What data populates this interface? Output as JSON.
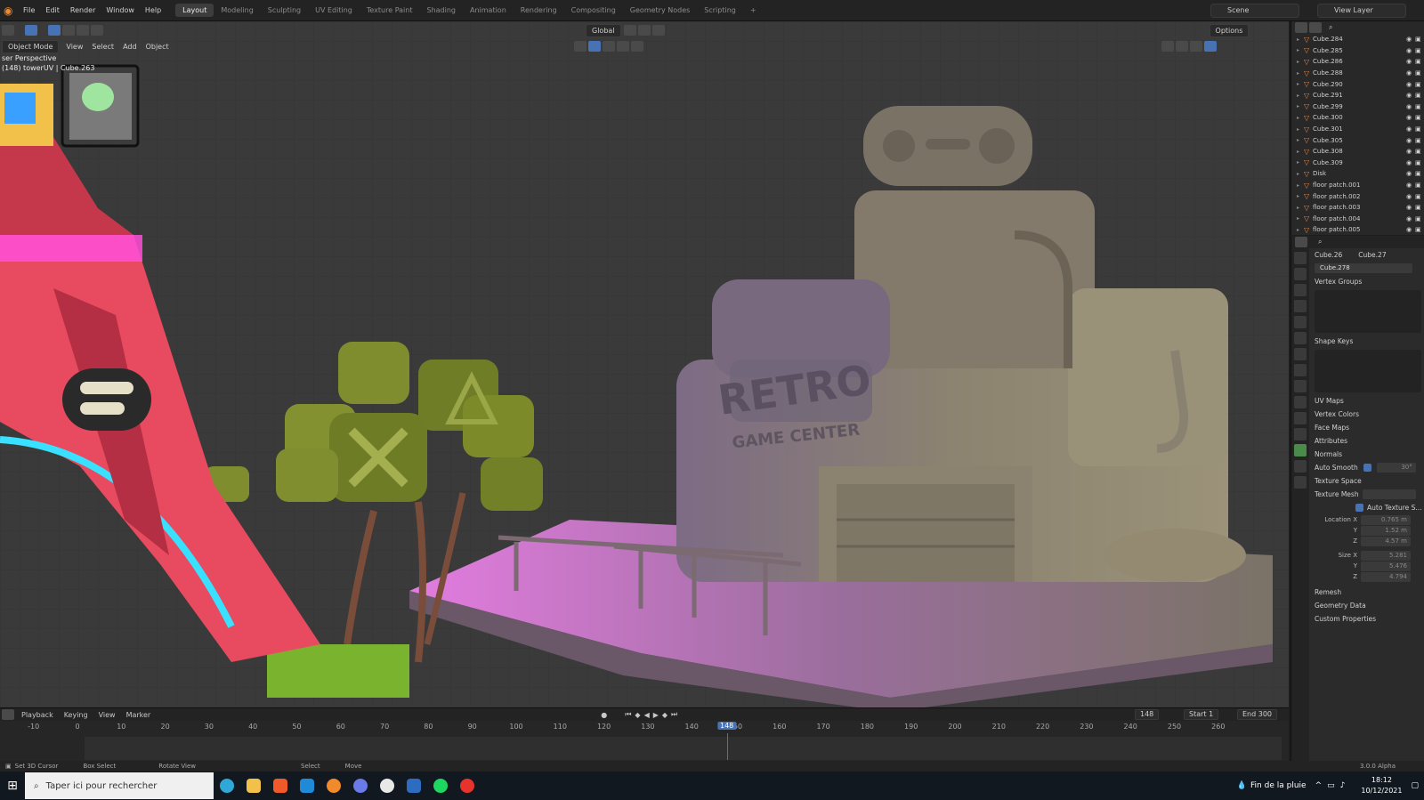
{
  "menu": [
    "File",
    "Edit",
    "Render",
    "Window",
    "Help"
  ],
  "workspaces": [
    "Layout",
    "Modeling",
    "Sculpting",
    "UV Editing",
    "Texture Paint",
    "Shading",
    "Animation",
    "Rendering",
    "Compositing",
    "Geometry Nodes",
    "Scripting"
  ],
  "active_workspace": "Layout",
  "scene": "Scene",
  "view_layer": "View Layer",
  "viewport": {
    "mode": "Object Mode",
    "menus": [
      "View",
      "Select",
      "Add",
      "Object"
    ],
    "orientation": "Global",
    "options": "Options",
    "overlay_line1": "ser Perspective",
    "overlay_line2": "(148) towerUV | Cube.263",
    "sign_retro": "RETRO",
    "sign_sub": "GAME CENTER"
  },
  "timeline": {
    "menus": [
      "Playback",
      "Keying",
      "View",
      "Marker"
    ],
    "ticks": [
      -10,
      0,
      10,
      20,
      30,
      40,
      50,
      60,
      70,
      80,
      90,
      100,
      110,
      120,
      130,
      140,
      150,
      160,
      170,
      180,
      190,
      200,
      210,
      220,
      230,
      240,
      250,
      260
    ],
    "current_frame": "148",
    "current_frame_value": 148,
    "start_label": "Start",
    "start": "1",
    "end_label": "End",
    "end": "300"
  },
  "statusbar": {
    "items": [
      "Set 3D Cursor",
      "Box Select",
      "Rotate View",
      "Select",
      "Move"
    ],
    "version": "3.0.0 Alpha"
  },
  "outliner": {
    "items": [
      "Cube.284",
      "Cube.285",
      "Cube.286",
      "Cube.288",
      "Cube.290",
      "Cube.291",
      "Cube.299",
      "Cube.300",
      "Cube.301",
      "Cube.305",
      "Cube.308",
      "Cube.309",
      "Disk",
      "floor patch.001",
      "floor patch.002",
      "floor patch.003",
      "floor patch.004",
      "floor patch.005"
    ]
  },
  "properties": {
    "object": "Cube.26",
    "mesh_ref": "Cube.27",
    "mesh_name": "Cube.278",
    "vertex_groups": "Vertex Groups",
    "shape_keys": "Shape Keys",
    "sections": [
      "UV Maps",
      "Vertex Colors",
      "Face Maps",
      "Attributes",
      "Normals"
    ],
    "auto_smooth": "Auto Smooth",
    "auto_smooth_angle": "30°",
    "texture_space": "Texture Space",
    "texture_mesh": "Texture Mesh",
    "auto_texture_space": "Auto Texture S...",
    "location": [
      {
        "label": "Location X",
        "value": "0.765 m"
      },
      {
        "label": "Y",
        "value": "1.52 m"
      },
      {
        "label": "Z",
        "value": "4.57 m"
      }
    ],
    "size": [
      {
        "label": "Size X",
        "value": "5.281"
      },
      {
        "label": "Y",
        "value": "5.476"
      },
      {
        "label": "Z",
        "value": "4.794"
      }
    ],
    "tail_sections": [
      "Remesh",
      "Geometry Data",
      "Custom Properties"
    ]
  },
  "taskbar": {
    "search_placeholder": "Taper ici pour rechercher",
    "weather": "Fin de la pluie",
    "time": "18:12",
    "date": "10/12/2021"
  },
  "colors": {
    "accent": "#4772b3",
    "tower": "#e84a5f",
    "neon": "#ff4fd8",
    "building": "#8a7f68",
    "tree": "#7c8a2a"
  }
}
